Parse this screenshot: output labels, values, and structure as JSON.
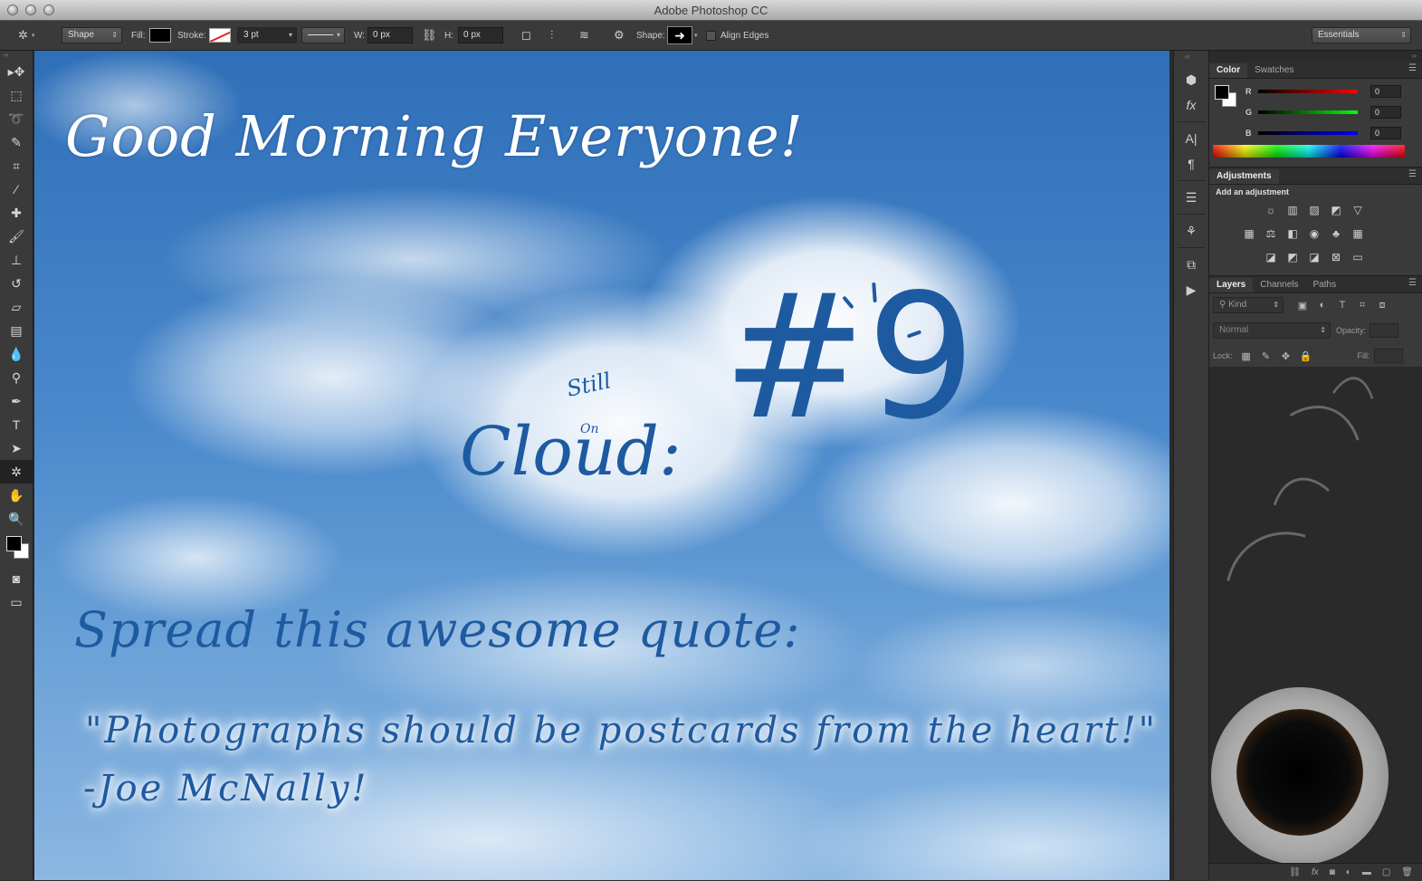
{
  "window": {
    "title": "Adobe Photoshop CC"
  },
  "options_bar": {
    "mode": "Shape",
    "fill_label": "Fill:",
    "stroke_label": "Stroke:",
    "stroke_width": "3 pt",
    "w_label": "W:",
    "w_value": "0 px",
    "h_label": "H:",
    "h_value": "0 px",
    "shape_label": "Shape:",
    "align_edges_label": "Align Edges",
    "workspace": "Essentials"
  },
  "toolbar": {
    "tools": [
      "move-icon",
      "marquee-icon",
      "lasso-icon",
      "quick-selection-icon",
      "crop-icon",
      "eyedropper-icon",
      "healing-brush-icon",
      "brush-icon",
      "clone-stamp-icon",
      "history-brush-icon",
      "eraser-icon",
      "gradient-icon",
      "blur-icon",
      "dodge-icon",
      "pen-icon",
      "type-icon",
      "path-selection-icon",
      "custom-shape-icon",
      "hand-icon",
      "zoom-icon"
    ],
    "active_tool": "custom-shape-icon",
    "foreground_color": "#000000",
    "background_color": "#ffffff"
  },
  "canvas": {
    "headline": "Good Morning Everyone!",
    "still": "Still",
    "on": "On",
    "cloud": "Cloud:",
    "number": "#9",
    "spread": "Spread this awesome quote:",
    "quote": "\"Photographs should be postcards from the heart!\"",
    "author": "-Joe McNally!",
    "text_color_white": "#ffffff",
    "text_color_blue": "#1e5aa0"
  },
  "panels": {
    "color": {
      "tabs": [
        "Color",
        "Swatches"
      ],
      "active_tab": "Color",
      "r_label": "R",
      "g_label": "G",
      "b_label": "B",
      "r_value": "0",
      "g_value": "0",
      "b_value": "0"
    },
    "adjustments": {
      "tab": "Adjustments",
      "subtitle": "Add an adjustment"
    },
    "layers": {
      "tabs": [
        "Layers",
        "Channels",
        "Paths"
      ],
      "active_tab": "Layers",
      "kind_filter": "Kind",
      "blend_mode": "Normal",
      "opacity_label": "Opacity:",
      "lock_label": "Lock:",
      "fill_label": "Fill:"
    }
  }
}
